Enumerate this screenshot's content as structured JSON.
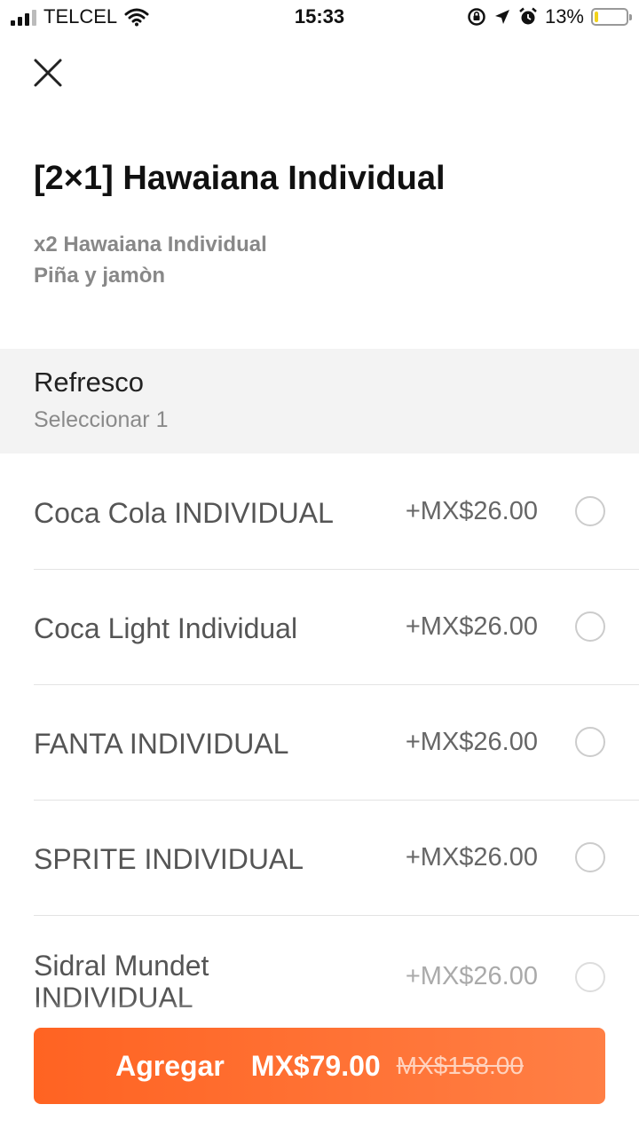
{
  "status_bar": {
    "carrier": "TELCEL",
    "time": "15:33",
    "battery_percent": "13%",
    "battery_level": 0.13,
    "icons": [
      "cellular-signal-icon",
      "wifi-icon",
      "rotation-lock-icon",
      "location-arrow-icon",
      "alarm-icon",
      "battery-icon"
    ]
  },
  "product": {
    "title": "[2×1] Hawaiana Individual",
    "description_line1": "x2 Hawaiana Individual",
    "description_line2": "Piña y jamòn"
  },
  "section": {
    "title": "Refresco",
    "subtitle": "Seleccionar 1"
  },
  "options": [
    {
      "name": "Coca Cola INDIVIDUAL",
      "price": "+MX$26.00"
    },
    {
      "name": "Coca Light Individual",
      "price": "+MX$26.00"
    },
    {
      "name": "FANTA INDIVIDUAL",
      "price": "+MX$26.00"
    },
    {
      "name": "SPRITE INDIVIDUAL",
      "price": "+MX$26.00"
    },
    {
      "name": "Sidral Mundet INDIVIDUAL",
      "price": "+MX$26.00"
    }
  ],
  "cta": {
    "label": "Agregar",
    "price": "MX$79.00",
    "original_price": "MX$158.00",
    "color": "#ff6322"
  }
}
